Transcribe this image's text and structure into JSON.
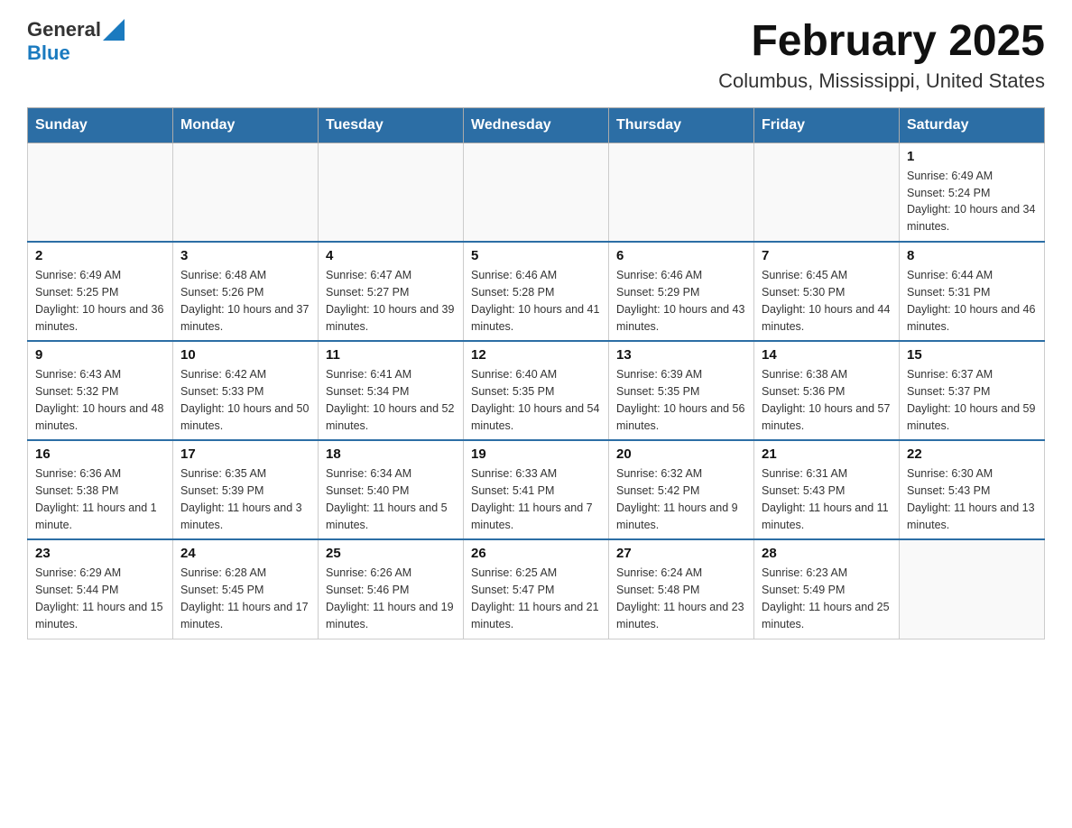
{
  "logo": {
    "general": "General",
    "blue": "Blue",
    "alt": "GeneralBlue logo"
  },
  "title": "February 2025",
  "subtitle": "Columbus, Mississippi, United States",
  "weekdays": [
    "Sunday",
    "Monday",
    "Tuesday",
    "Wednesday",
    "Thursday",
    "Friday",
    "Saturday"
  ],
  "weeks": [
    [
      {
        "day": "",
        "info": ""
      },
      {
        "day": "",
        "info": ""
      },
      {
        "day": "",
        "info": ""
      },
      {
        "day": "",
        "info": ""
      },
      {
        "day": "",
        "info": ""
      },
      {
        "day": "",
        "info": ""
      },
      {
        "day": "1",
        "info": "Sunrise: 6:49 AM\nSunset: 5:24 PM\nDaylight: 10 hours and 34 minutes."
      }
    ],
    [
      {
        "day": "2",
        "info": "Sunrise: 6:49 AM\nSunset: 5:25 PM\nDaylight: 10 hours and 36 minutes."
      },
      {
        "day": "3",
        "info": "Sunrise: 6:48 AM\nSunset: 5:26 PM\nDaylight: 10 hours and 37 minutes."
      },
      {
        "day": "4",
        "info": "Sunrise: 6:47 AM\nSunset: 5:27 PM\nDaylight: 10 hours and 39 minutes."
      },
      {
        "day": "5",
        "info": "Sunrise: 6:46 AM\nSunset: 5:28 PM\nDaylight: 10 hours and 41 minutes."
      },
      {
        "day": "6",
        "info": "Sunrise: 6:46 AM\nSunset: 5:29 PM\nDaylight: 10 hours and 43 minutes."
      },
      {
        "day": "7",
        "info": "Sunrise: 6:45 AM\nSunset: 5:30 PM\nDaylight: 10 hours and 44 minutes."
      },
      {
        "day": "8",
        "info": "Sunrise: 6:44 AM\nSunset: 5:31 PM\nDaylight: 10 hours and 46 minutes."
      }
    ],
    [
      {
        "day": "9",
        "info": "Sunrise: 6:43 AM\nSunset: 5:32 PM\nDaylight: 10 hours and 48 minutes."
      },
      {
        "day": "10",
        "info": "Sunrise: 6:42 AM\nSunset: 5:33 PM\nDaylight: 10 hours and 50 minutes."
      },
      {
        "day": "11",
        "info": "Sunrise: 6:41 AM\nSunset: 5:34 PM\nDaylight: 10 hours and 52 minutes."
      },
      {
        "day": "12",
        "info": "Sunrise: 6:40 AM\nSunset: 5:35 PM\nDaylight: 10 hours and 54 minutes."
      },
      {
        "day": "13",
        "info": "Sunrise: 6:39 AM\nSunset: 5:35 PM\nDaylight: 10 hours and 56 minutes."
      },
      {
        "day": "14",
        "info": "Sunrise: 6:38 AM\nSunset: 5:36 PM\nDaylight: 10 hours and 57 minutes."
      },
      {
        "day": "15",
        "info": "Sunrise: 6:37 AM\nSunset: 5:37 PM\nDaylight: 10 hours and 59 minutes."
      }
    ],
    [
      {
        "day": "16",
        "info": "Sunrise: 6:36 AM\nSunset: 5:38 PM\nDaylight: 11 hours and 1 minute."
      },
      {
        "day": "17",
        "info": "Sunrise: 6:35 AM\nSunset: 5:39 PM\nDaylight: 11 hours and 3 minutes."
      },
      {
        "day": "18",
        "info": "Sunrise: 6:34 AM\nSunset: 5:40 PM\nDaylight: 11 hours and 5 minutes."
      },
      {
        "day": "19",
        "info": "Sunrise: 6:33 AM\nSunset: 5:41 PM\nDaylight: 11 hours and 7 minutes."
      },
      {
        "day": "20",
        "info": "Sunrise: 6:32 AM\nSunset: 5:42 PM\nDaylight: 11 hours and 9 minutes."
      },
      {
        "day": "21",
        "info": "Sunrise: 6:31 AM\nSunset: 5:43 PM\nDaylight: 11 hours and 11 minutes."
      },
      {
        "day": "22",
        "info": "Sunrise: 6:30 AM\nSunset: 5:43 PM\nDaylight: 11 hours and 13 minutes."
      }
    ],
    [
      {
        "day": "23",
        "info": "Sunrise: 6:29 AM\nSunset: 5:44 PM\nDaylight: 11 hours and 15 minutes."
      },
      {
        "day": "24",
        "info": "Sunrise: 6:28 AM\nSunset: 5:45 PM\nDaylight: 11 hours and 17 minutes."
      },
      {
        "day": "25",
        "info": "Sunrise: 6:26 AM\nSunset: 5:46 PM\nDaylight: 11 hours and 19 minutes."
      },
      {
        "day": "26",
        "info": "Sunrise: 6:25 AM\nSunset: 5:47 PM\nDaylight: 11 hours and 21 minutes."
      },
      {
        "day": "27",
        "info": "Sunrise: 6:24 AM\nSunset: 5:48 PM\nDaylight: 11 hours and 23 minutes."
      },
      {
        "day": "28",
        "info": "Sunrise: 6:23 AM\nSunset: 5:49 PM\nDaylight: 11 hours and 25 minutes."
      },
      {
        "day": "",
        "info": ""
      }
    ]
  ]
}
